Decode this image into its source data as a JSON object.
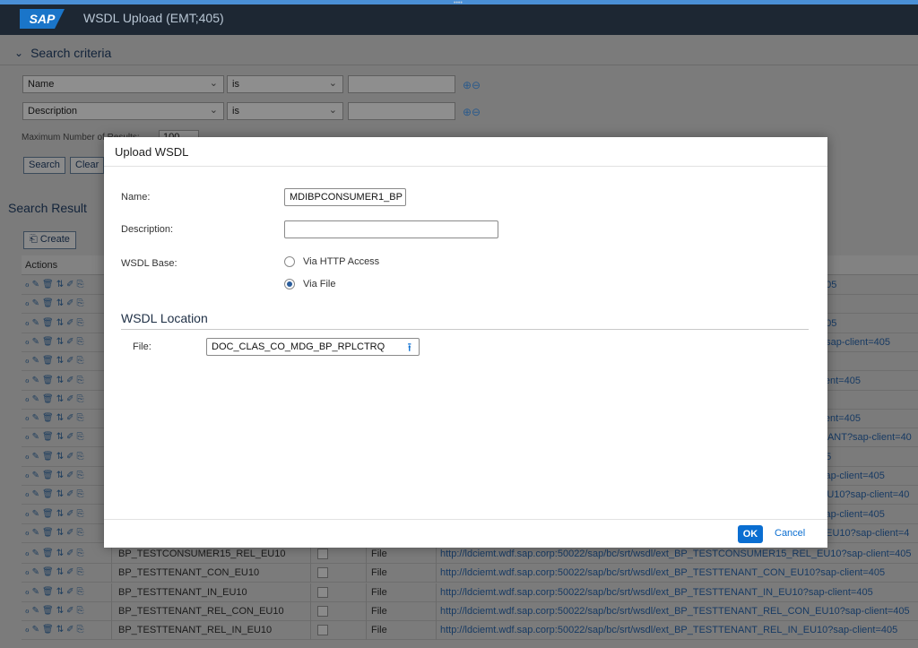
{
  "app": {
    "logo": "SAP",
    "title": "WSDL Upload (EMT;405)"
  },
  "criteria": {
    "title": "Search criteria",
    "rows": [
      {
        "field": "Name",
        "operator": "is",
        "value": ""
      },
      {
        "field": "Description",
        "operator": "is",
        "value": ""
      }
    ],
    "plus_minus": "⊕⊖",
    "max_results_label": "Maximum Number of Results:",
    "max_results_value": "100",
    "search_label": "Search",
    "clear_label": "Clear"
  },
  "results": {
    "title": "Search Result",
    "create_label": "Create",
    "actions_header": "Actions",
    "action_icons": "ℴ✎🗑⇅✐⎘",
    "right_urls": [
      "405",
      "",
      "405",
      "?sap-client=405",
      "",
      "lient=405",
      "5",
      "lient=405",
      "NANT?sap-client=40",
      "05",
      "sap-client=405",
      "EU10?sap-client=40",
      "sap-client=405",
      "_EU10?sap-client=4"
    ],
    "rows": [
      {
        "name": "BP_TESTCONSUMER15_REL_EU10",
        "source": "File",
        "url": "http://ldciemt.wdf.sap.corp:50022/sap/bc/srt/wsdl/ext_BP_TESTCONSUMER15_REL_EU10?sap-client=405"
      },
      {
        "name": "BP_TESTTENANT_CON_EU10",
        "source": "File",
        "url": "http://ldciemt.wdf.sap.corp:50022/sap/bc/srt/wsdl/ext_BP_TESTTENANT_CON_EU10?sap-client=405"
      },
      {
        "name": "BP_TESTTENANT_IN_EU10",
        "source": "File",
        "url": "http://ldciemt.wdf.sap.corp:50022/sap/bc/srt/wsdl/ext_BP_TESTTENANT_IN_EU10?sap-client=405"
      },
      {
        "name": "BP_TESTTENANT_REL_CON_EU10",
        "source": "File",
        "url": "http://ldciemt.wdf.sap.corp:50022/sap/bc/srt/wsdl/ext_BP_TESTTENANT_REL_CON_EU10?sap-client=405"
      },
      {
        "name": "BP_TESTTENANT_REL_IN_EU10",
        "source": "File",
        "url": "http://ldciemt.wdf.sap.corp:50022/sap/bc/srt/wsdl/ext_BP_TESTTENANT_REL_IN_EU10?sap-client=405"
      }
    ]
  },
  "dialog": {
    "title": "Upload WSDL",
    "name_label": "Name:",
    "name_value": "MDIBPCONSUMER1_BP",
    "description_label": "Description:",
    "description_value": "",
    "base_label": "WSDL Base:",
    "radio_http": "Via HTTP Access",
    "radio_file": "Via File",
    "selected_base": "Via File",
    "location_title": "WSDL Location",
    "file_label": "File:",
    "file_value": "DOC_CLAS_CO_MDG_BP_RPLCTRQ",
    "ok_label": "OK",
    "cancel_label": "Cancel"
  }
}
